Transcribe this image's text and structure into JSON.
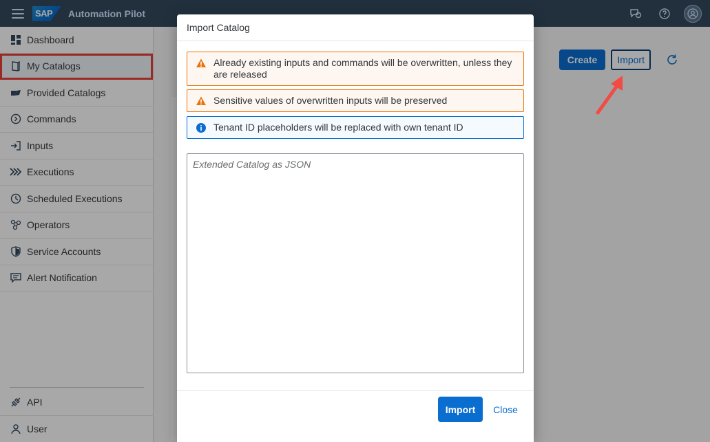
{
  "shell": {
    "logo_text": "SAP",
    "title": "Automation Pilot",
    "icons": [
      "menu-icon",
      "feedback-icon",
      "help-icon",
      "user-avatar-icon"
    ]
  },
  "sidebar": {
    "items": [
      {
        "label": "Dashboard",
        "icon": "dashboard-icon"
      },
      {
        "label": "My Catalogs",
        "icon": "catalog-icon",
        "selected": true
      },
      {
        "label": "Provided Catalogs",
        "icon": "provided-catalog-icon"
      },
      {
        "label": "Commands",
        "icon": "command-icon"
      },
      {
        "label": "Inputs",
        "icon": "input-icon"
      },
      {
        "label": "Executions",
        "icon": "execution-icon"
      },
      {
        "label": "Scheduled Executions",
        "icon": "clock-icon"
      },
      {
        "label": "Operators",
        "icon": "operator-icon"
      },
      {
        "label": "Service Accounts",
        "icon": "shield-icon"
      },
      {
        "label": "Alert Notification",
        "icon": "message-icon"
      }
    ],
    "footer": [
      {
        "label": "API",
        "icon": "api-icon"
      },
      {
        "label": "User",
        "icon": "user-icon"
      }
    ]
  },
  "toolbar": {
    "create_label": "Create",
    "import_label": "Import"
  },
  "dialog": {
    "title": "Import Catalog",
    "messages": [
      {
        "type": "warning",
        "text": "Already existing inputs and commands will be overwritten, unless they are released"
      },
      {
        "type": "warning",
        "text": "Sensitive values of overwritten inputs will be preserved"
      },
      {
        "type": "information",
        "text": "Tenant ID placeholders will be replaced with own tenant ID"
      }
    ],
    "textarea_placeholder": "Extended Catalog as JSON",
    "import_label": "Import",
    "close_label": "Close"
  },
  "colors": {
    "shell": "#354a5f",
    "accent": "#0a6ed1",
    "warning": "#e9730c",
    "highlight": "#e8403a"
  }
}
